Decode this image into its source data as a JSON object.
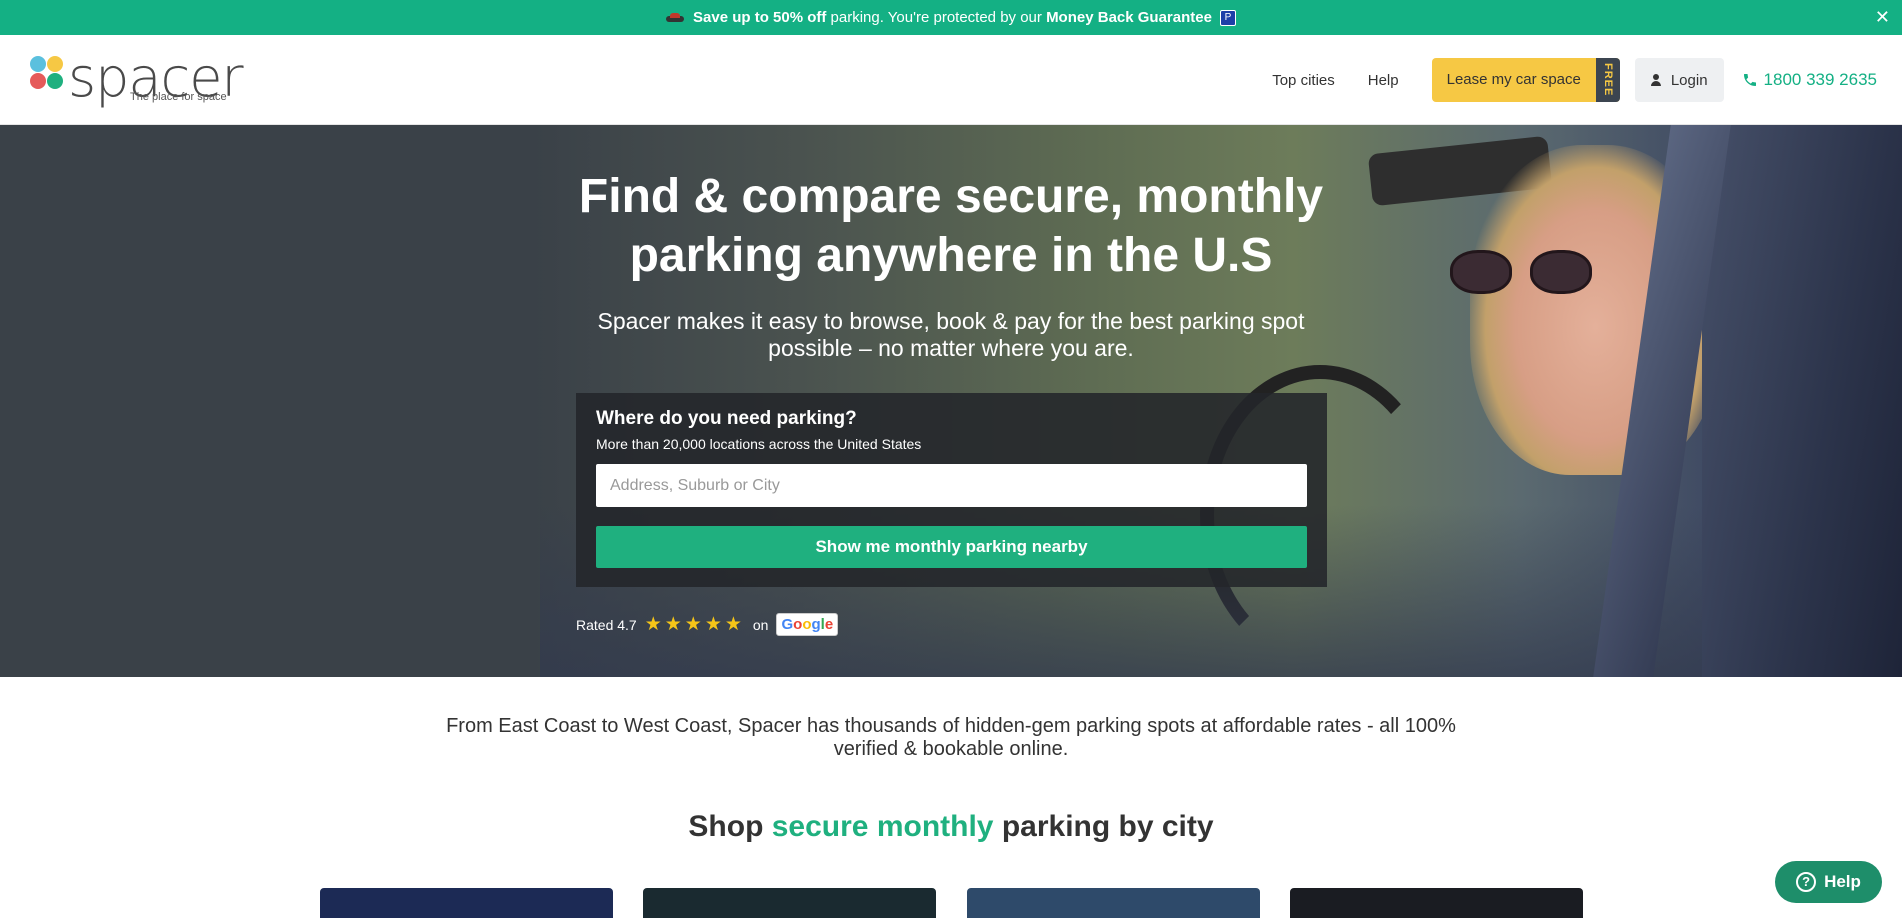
{
  "promo": {
    "bold_1": "Save up to 50% off",
    "text_1": " parking. You're protected by our ",
    "bold_2": "Money Back Guarantee",
    "badge": "P",
    "close": "✕"
  },
  "header": {
    "logo_word": "spacer",
    "logo_tagline": "The place for space",
    "logo_colors": [
      "#5bc0de",
      "#f6c844",
      "#e55a5a",
      "#1fb07f"
    ],
    "nav": {
      "top_cities": "Top cities",
      "help": "Help",
      "lease_label": "Lease my car space",
      "lease_badge": "FREE",
      "login": "Login",
      "phone": "1800 339 2635"
    }
  },
  "hero": {
    "title": "Find & compare secure, monthly parking anywhere in the U.S",
    "subtitle": "Spacer makes it easy to browse, book & pay for the best parking spot possible – no matter where you are.",
    "search": {
      "question": "Where do you need parking?",
      "sub": "More than 20,000 locations across the United States",
      "placeholder": "Address, Suburb or City",
      "value": "",
      "button": "Show me monthly parking nearby"
    },
    "rating": {
      "label": "Rated 4.7",
      "stars": 5,
      "stars_glyphs": "★★★★★",
      "on": "on",
      "source": "Google"
    }
  },
  "blurb": "From East Coast to West Coast, Spacer has thousands of hidden-gem parking spots at affordable rates - all 100% verified & bookable online.",
  "shop": {
    "prefix": "Shop ",
    "highlight": "secure monthly",
    "suffix": " parking by city"
  },
  "city_cards_colors": [
    "#1c2a55",
    "#1a2a30",
    "#2e4a6a",
    "#1a1c22"
  ],
  "help_widget": {
    "label": "Help",
    "icon": "?"
  },
  "colors": {
    "brand_green": "#14b084",
    "button_green": "#1fb07f",
    "lease_yellow": "#f6c844"
  }
}
